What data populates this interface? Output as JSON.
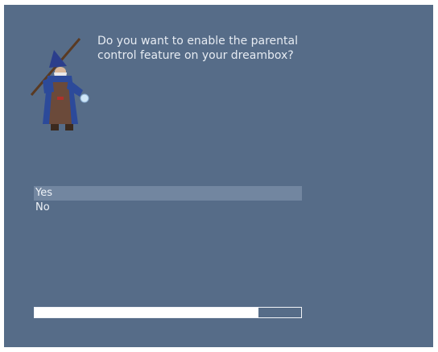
{
  "wizard": {
    "icon": "wizard-mascot-icon",
    "question": "Do you want to enable the parental control feature on your dreambox?"
  },
  "choices": [
    {
      "label": "Yes",
      "selected": true
    },
    {
      "label": "No",
      "selected": false
    }
  ],
  "progress": {
    "fraction": 0.84
  },
  "colors": {
    "background": "#566c88",
    "selection": "#7286a0",
    "text": "#e6ebf2",
    "progress_fill": "#ffffff"
  }
}
